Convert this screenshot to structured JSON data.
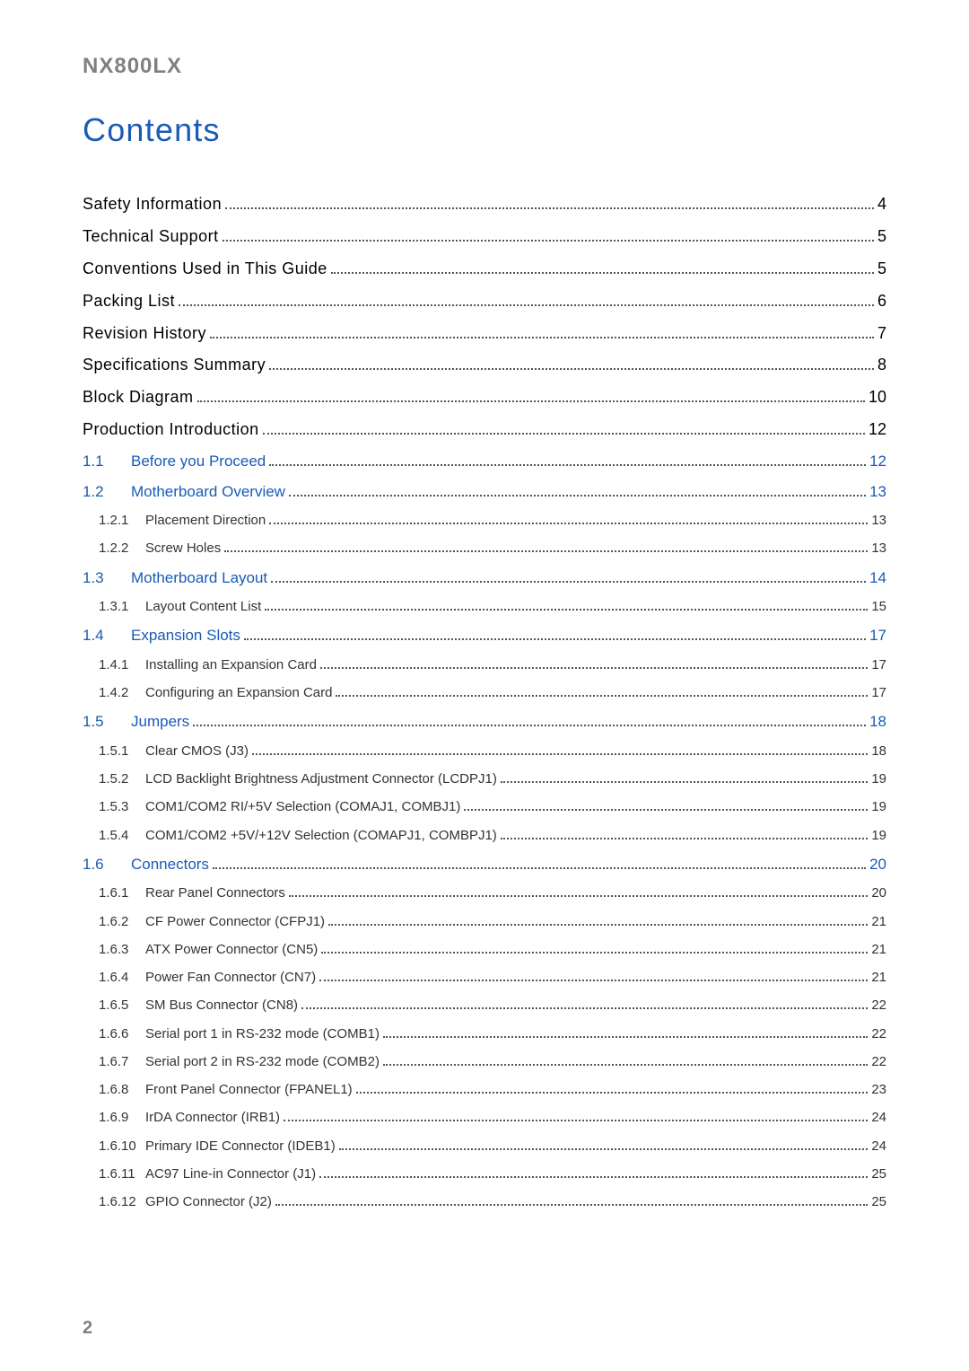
{
  "header": "NX800LX",
  "title": "Contents",
  "page_number": "2",
  "toc": [
    {
      "level": 0,
      "num": "",
      "label": "Safety Information",
      "page": "4"
    },
    {
      "level": 0,
      "num": "",
      "label": "Technical Support",
      "page": "5"
    },
    {
      "level": 0,
      "num": "",
      "label": "Conventions Used in This Guide",
      "page": "5"
    },
    {
      "level": 0,
      "num": "",
      "label": "Packing List",
      "page": "6"
    },
    {
      "level": 0,
      "num": "",
      "label": "Revision History",
      "page": "7"
    },
    {
      "level": 0,
      "num": "",
      "label": "Specifications Summary",
      "page": "8"
    },
    {
      "level": 0,
      "num": "",
      "label": "Block Diagram",
      "page": "10"
    },
    {
      "level": 0,
      "num": "",
      "label": "Production Introduction",
      "page": "12"
    },
    {
      "level": 1,
      "num": "1.1",
      "label": "Before you Proceed",
      "page": "12"
    },
    {
      "level": 1,
      "num": "1.2",
      "label": "Motherboard Overview",
      "page": "13"
    },
    {
      "level": 2,
      "num": "1.2.1",
      "label": "Placement Direction",
      "page": "13"
    },
    {
      "level": 2,
      "num": "1.2.2",
      "label": "Screw Holes",
      "page": "13"
    },
    {
      "level": 1,
      "num": "1.3",
      "label": "Motherboard Layout",
      "page": "14"
    },
    {
      "level": 2,
      "num": "1.3.1",
      "label": "Layout Content List",
      "page": "15"
    },
    {
      "level": 1,
      "num": "1.4",
      "label": "Expansion Slots",
      "page": "17"
    },
    {
      "level": 2,
      "num": "1.4.1",
      "label": "Installing an Expansion Card",
      "page": "17"
    },
    {
      "level": 2,
      "num": "1.4.2",
      "label": "Configuring an Expansion Card",
      "page": "17"
    },
    {
      "level": 1,
      "num": "1.5",
      "label": "Jumpers",
      "page": "18"
    },
    {
      "level": 2,
      "num": "1.5.1",
      "label": "Clear CMOS (J3)",
      "page": "18"
    },
    {
      "level": 2,
      "num": "1.5.2",
      "label": "LCD Backlight Brightness Adjustment Connector (LCDPJ1)",
      "page": "19"
    },
    {
      "level": 2,
      "num": "1.5.3",
      "label": "COM1/COM2 RI/+5V Selection (COMAJ1, COMBJ1)",
      "page": "19"
    },
    {
      "level": 2,
      "num": "1.5.4",
      "label": "COM1/COM2 +5V/+12V Selection (COMAPJ1, COMBPJ1)",
      "page": "19"
    },
    {
      "level": 1,
      "num": "1.6",
      "label": "Connectors",
      "page": "20"
    },
    {
      "level": 2,
      "num": "1.6.1",
      "label": "Rear Panel Connectors",
      "page": "20"
    },
    {
      "level": 2,
      "num": "1.6.2",
      "label": "CF Power Connector (CFPJ1)",
      "page": "21"
    },
    {
      "level": 2,
      "num": "1.6.3",
      "label": "ATX Power Connector (CN5)",
      "page": "21"
    },
    {
      "level": 2,
      "num": "1.6.4",
      "label": "Power Fan Connector (CN7)",
      "page": "21"
    },
    {
      "level": 2,
      "num": "1.6.5",
      "label": "SM Bus Connector (CN8)",
      "page": "22"
    },
    {
      "level": 2,
      "num": "1.6.6",
      "label": "Serial port 1 in RS-232 mode (COMB1)",
      "page": "22"
    },
    {
      "level": 2,
      "num": "1.6.7",
      "label": "Serial port 2 in RS-232 mode (COMB2)",
      "page": "22"
    },
    {
      "level": 2,
      "num": "1.6.8",
      "label": "Front Panel Connector (FPANEL1)",
      "page": "23"
    },
    {
      "level": 2,
      "num": "1.6.9",
      "label": "IrDA Connector (IRB1)",
      "page": "24"
    },
    {
      "level": 2,
      "num": "1.6.10",
      "label": "Primary IDE Connector (IDEB1)",
      "page": "24"
    },
    {
      "level": 2,
      "num": "1.6.11",
      "label": "AC97 Line-in Connector (J1)",
      "page": "25"
    },
    {
      "level": 2,
      "num": "1.6.12",
      "label": "GPIO Connector (J2)",
      "page": "25"
    }
  ]
}
